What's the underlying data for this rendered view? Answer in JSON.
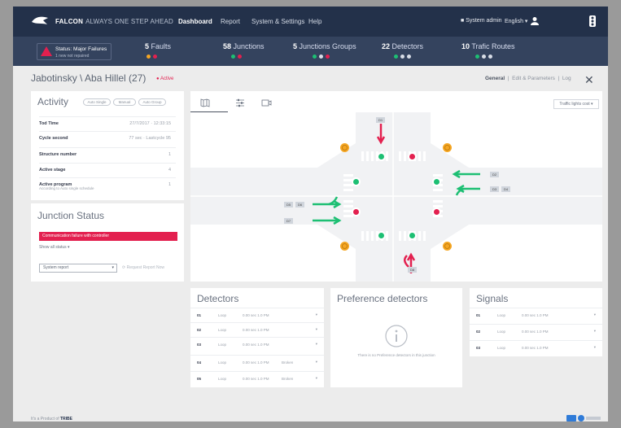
{
  "app": {
    "brand": "FALCON",
    "tagline": "ALWAYS ONE STEP AHEAD"
  },
  "nav": [
    {
      "label": "Dashboard"
    },
    {
      "label": "Report"
    },
    {
      "label": "System & Settings"
    },
    {
      "label": "Help"
    }
  ],
  "top_right": {
    "system_label": "System admin",
    "language": "English ▾"
  },
  "status": {
    "title": "Status: Major Failures",
    "subtitle": "1 new not repaired"
  },
  "stats": [
    {
      "count": "5",
      "label": "Faults",
      "dots": [
        "o",
        "r"
      ]
    },
    {
      "count": "58",
      "label": "Junctions",
      "dots": [
        "g",
        "r"
      ]
    },
    {
      "count": "5",
      "label": "Junctions Groups",
      "dots": [
        "g",
        "w",
        "r"
      ]
    },
    {
      "count": "22",
      "label": "Detectors",
      "dots": [
        "g",
        "w",
        "w"
      ]
    },
    {
      "count": "10",
      "label": "Trafic Routes",
      "dots": [
        "g",
        "w",
        "w"
      ]
    }
  ],
  "junction": {
    "breadcrumb": "Jabotinsky \\ Aba Hillel (27)",
    "state": "● Active"
  },
  "header_links": {
    "general": "General",
    "edit": "Edit & Parameters",
    "log": "Log"
  },
  "activity": {
    "title": "Activity",
    "pills": [
      "Auto Single",
      "Manual",
      "Auto Group"
    ],
    "rows": [
      {
        "label": "Tod Time",
        "value": "27/7/2017 · 12:33:15",
        "sub": ""
      },
      {
        "label": "Cycle second",
        "value": "77 sec · Lastcycle 95",
        "sub": ""
      },
      {
        "label": "Structure number",
        "value": "1",
        "sub": ""
      },
      {
        "label": "Active stage",
        "value": "4",
        "sub": ""
      },
      {
        "label": "Active program",
        "value": "1",
        "sub": "According to Auto single schedule"
      }
    ]
  },
  "junction_status": {
    "title": "Junction Status",
    "alert": "Communication failure with controller",
    "link": "Show all status ▾",
    "select": "System report",
    "action": "Request Report Now"
  },
  "map": {
    "layer_select": "Traffic lights cost ▾",
    "detectors": [
      "D1",
      "D2",
      "D3",
      "D4",
      "D5",
      "D6",
      "D7",
      "D8"
    ]
  },
  "detectors": {
    "title": "Detectors",
    "rows": [
      {
        "id": "01",
        "type": "Loop",
        "time": "0.00 sec 1.0 PM",
        "status": ""
      },
      {
        "id": "02",
        "type": "Loop",
        "time": "0.00 sec 1.0 PM",
        "status": ""
      },
      {
        "id": "03",
        "type": "Loop",
        "time": "0.00 sec 1.0 PM",
        "status": ""
      },
      {
        "id": "04",
        "type": "Loop",
        "time": "0.00 sec 1.0 PM",
        "status": "Broken"
      },
      {
        "id": "05",
        "type": "Loop",
        "time": "0.00 sec 1.0 PM",
        "status": "Broken"
      }
    ]
  },
  "preference": {
    "title": "Preference detectors",
    "empty_text": "There is no Preference detectors in this junction"
  },
  "signals": {
    "title": "Signals",
    "rows": [
      {
        "id": "01",
        "type": "Loop",
        "time": "0.00 sec 1.0 PM"
      },
      {
        "id": "02",
        "type": "Loop",
        "time": "0.00 sec 1.0 PM"
      },
      {
        "id": "03",
        "type": "Loop",
        "time": "0.00 sec 1.0 PM"
      }
    ]
  },
  "footer": {
    "prefix": "It's a Product of",
    "company": "TRIBE"
  },
  "colors": {
    "topbar": "#23314a",
    "statbar": "#34435e",
    "danger": "#e3204f",
    "ok": "#1dbf73",
    "warn": "#f5a623"
  }
}
